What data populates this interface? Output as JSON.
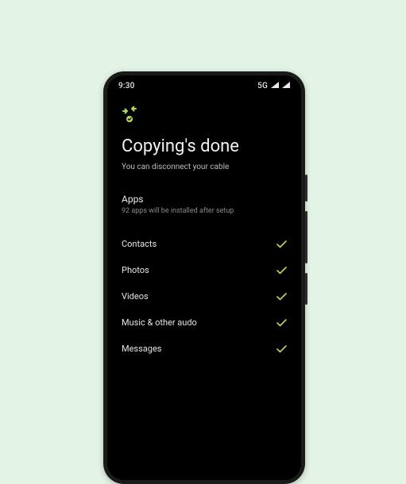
{
  "status": {
    "time": "9:30",
    "network": "5G"
  },
  "accent": "#B7D957",
  "title": "Copying's done",
  "subtitle": "You can disconnect your cable",
  "apps": {
    "label": "Apps",
    "desc": "92 apps will be installed after setup"
  },
  "items": [
    {
      "label": "Contacts"
    },
    {
      "label": "Photos"
    },
    {
      "label": "Videos"
    },
    {
      "label": "Music & other audo"
    },
    {
      "label": "Messages"
    }
  ]
}
